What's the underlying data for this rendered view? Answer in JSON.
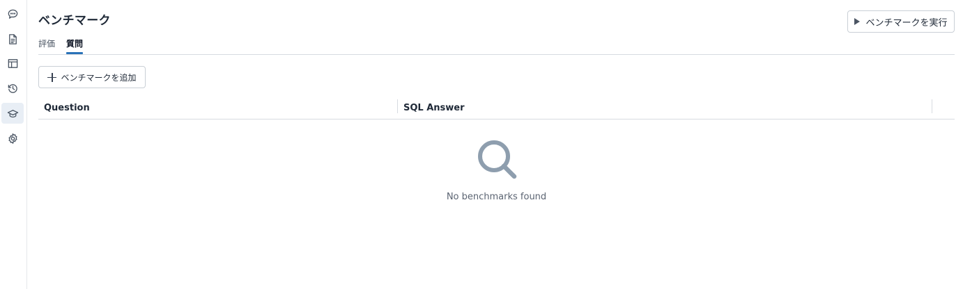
{
  "rail": {
    "items": [
      {
        "icon": "chat-bubble-icon",
        "active": false
      },
      {
        "icon": "document-icon",
        "active": false
      },
      {
        "icon": "table-icon",
        "active": false
      },
      {
        "icon": "history-icon",
        "active": false
      },
      {
        "icon": "graduation-cap-icon",
        "active": true
      },
      {
        "icon": "gear-icon",
        "active": false
      }
    ]
  },
  "header": {
    "title": "ベンチマーク",
    "run_button_label": "ベンチマークを実行"
  },
  "tabs": [
    {
      "label": "評価",
      "active": false
    },
    {
      "label": "質問",
      "active": true
    }
  ],
  "toolbar": {
    "add_button_label": "ベンチマークを追加"
  },
  "table": {
    "columns": [
      "Question",
      "SQL Answer"
    ],
    "rows": []
  },
  "empty_state": {
    "icon": "search-icon",
    "message": "No benchmarks found"
  },
  "colors": {
    "accent": "#2a72b8",
    "active_rail_bg": "#e8eef5",
    "empty_icon": "#8e9eae"
  }
}
